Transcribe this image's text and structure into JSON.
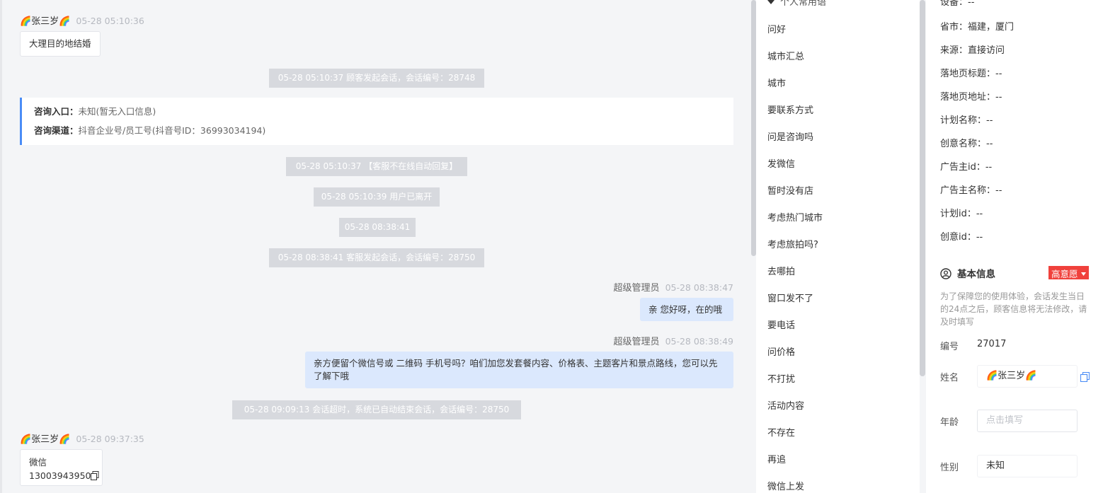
{
  "chat": {
    "msg1": {
      "sender": "🌈张三岁🌈",
      "time": "05-28 05:10:36",
      "text": "大理目的地结婚"
    },
    "sys1": "05-28 05:10:37 顾客发起会话，会话编号：28748",
    "entry_label": "咨询入口：",
    "entry_value": "未知(暂无入口信息)",
    "channel_label": "咨询渠道：",
    "channel_value": "抖音企业号/员工号(抖音号ID：36993034194)",
    "sys2": "05-28 05:10:37 【客服不在线自动回复】",
    "sys3": "05-28 05:10:39 用户已离开",
    "sys4": "05-28 08:38:41",
    "sys5": "05-28 08:38:41 客服发起会话，会话编号：28750",
    "agent1": {
      "name": "超级管理员",
      "time": "05-28 08:38:47",
      "text": "亲 您好呀，在的哦"
    },
    "agent2": {
      "name": "超级管理员",
      "time": "05-28 08:38:49",
      "text": "亲方便留个微信号或 二维码 手机号吗？咱们加您发套餐内容、价格表、主题客片和景点路线，您可以先了解下哦"
    },
    "sys6": "05-28 09:09:13 会话超时，系统已自动结束会话，会话编号：28750",
    "msg2": {
      "sender": "🌈张三岁🌈",
      "time": "05-28 09:37:35",
      "label": "微信",
      "number": "13003943950"
    }
  },
  "quick_replies": {
    "header": "个人常用语",
    "items": [
      "问好",
      "城市汇总",
      "城市",
      "要联系方式",
      "问是咨询吗",
      "发微信",
      "暂时没有店",
      "考虑热门城市",
      "考虑旅拍吗?",
      "去哪拍",
      "窗口发不了",
      "要电话",
      "问价格",
      "不打扰",
      "活动内容",
      "不存在",
      "再追",
      "微信上发"
    ]
  },
  "customer": {
    "device": "设备：--",
    "province": "省市：福建，厦门",
    "source": "来源：直接访问",
    "landing_title": "落地页标题：--",
    "landing_url": "落地页地址：--",
    "plan_name": "计划名称：--",
    "creative_name": "创意名称：--",
    "advertiser_id": "广告主id：--",
    "advertiser_name": "广告主名称：--",
    "plan_id": "计划id：--",
    "creative_id": "创意id：--",
    "section_title": "基本信息",
    "intent_tag": "高意愿",
    "note": "为了保障您的使用体验，会话发生当日的24点之后，顾客信息将无法修改，请及时填写",
    "id_label": "编号",
    "id_value": "27017",
    "name_label": "姓名",
    "name_value": "🌈张三岁🌈",
    "age_label": "年龄",
    "age_placeholder": "点击填写",
    "gender_label": "性别",
    "gender_value": "未知"
  },
  "colors": {
    "accent": "#4a8cf6",
    "tag": "#f0413c",
    "agent_bubble": "#dbe8fd"
  }
}
